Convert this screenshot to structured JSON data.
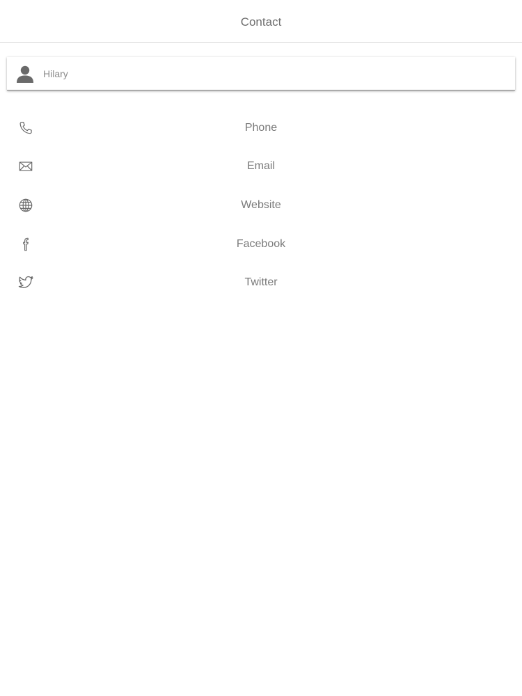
{
  "header": {
    "title": "Contact"
  },
  "contact": {
    "name": "Hilary",
    "avatar_icon": "person-icon"
  },
  "actions": [
    {
      "label": "Phone",
      "icon": "phone-icon"
    },
    {
      "label": "Email",
      "icon": "envelope-icon"
    },
    {
      "label": "Website",
      "icon": "globe-icon"
    },
    {
      "label": "Facebook",
      "icon": "facebook-icon"
    },
    {
      "label": "Twitter",
      "icon": "twitter-bird-icon"
    }
  ],
  "colors": {
    "text": "#7a7a7a",
    "divider": "#d6d6d6",
    "icon": "#6a6a6a",
    "background": "#ffffff"
  }
}
